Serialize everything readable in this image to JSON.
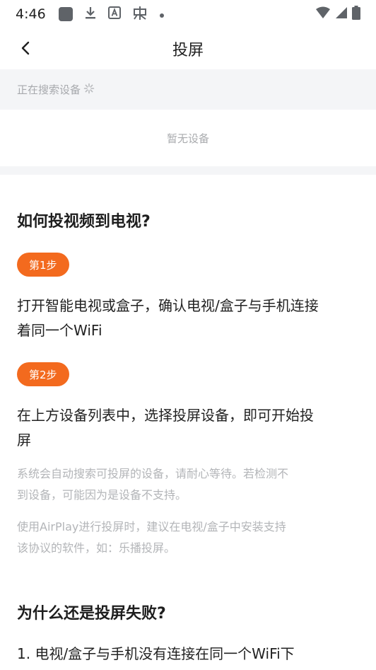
{
  "status_bar": {
    "time": "4:46",
    "left_icons": [
      "square-app-icon",
      "download-icon",
      "font-a-icon",
      "bug-icon",
      "dot-icon"
    ],
    "right_icons": [
      "wifi-icon",
      "signal-icon",
      "battery-icon"
    ]
  },
  "nav": {
    "title": "投屏"
  },
  "devices": {
    "searching_text": "正在搜索设备",
    "empty_text": "暂无设备"
  },
  "guide": {
    "heading": "如何投视频到电视?",
    "steps": [
      {
        "badge": "第1步",
        "line1": "打开智能电视或盒子，确认电视/盒子与手机连接",
        "line2": "着同一个WiFi"
      },
      {
        "badge": "第2步",
        "line1": "在上方设备列表中，选择投屏设备，即可开始投",
        "line2": "屏"
      }
    ],
    "notes": [
      {
        "line1": "系统会自动搜索可投屏的设备，请耐心等待。若检测不",
        "line2": "到设备，可能因为是设备不支持。"
      },
      {
        "line1": "使用AirPlay进行投屏时，建议在电视/盒子中安装支持",
        "line2": "该协议的软件，如：乐播投屏。"
      }
    ]
  },
  "failure": {
    "heading": "为什么还是投屏失败?",
    "item1": "1. 电视/盒子与手机没有连接在同一个WiFi下"
  },
  "colors": {
    "accent": "#f36a1e",
    "band": "#f4f5f7"
  }
}
